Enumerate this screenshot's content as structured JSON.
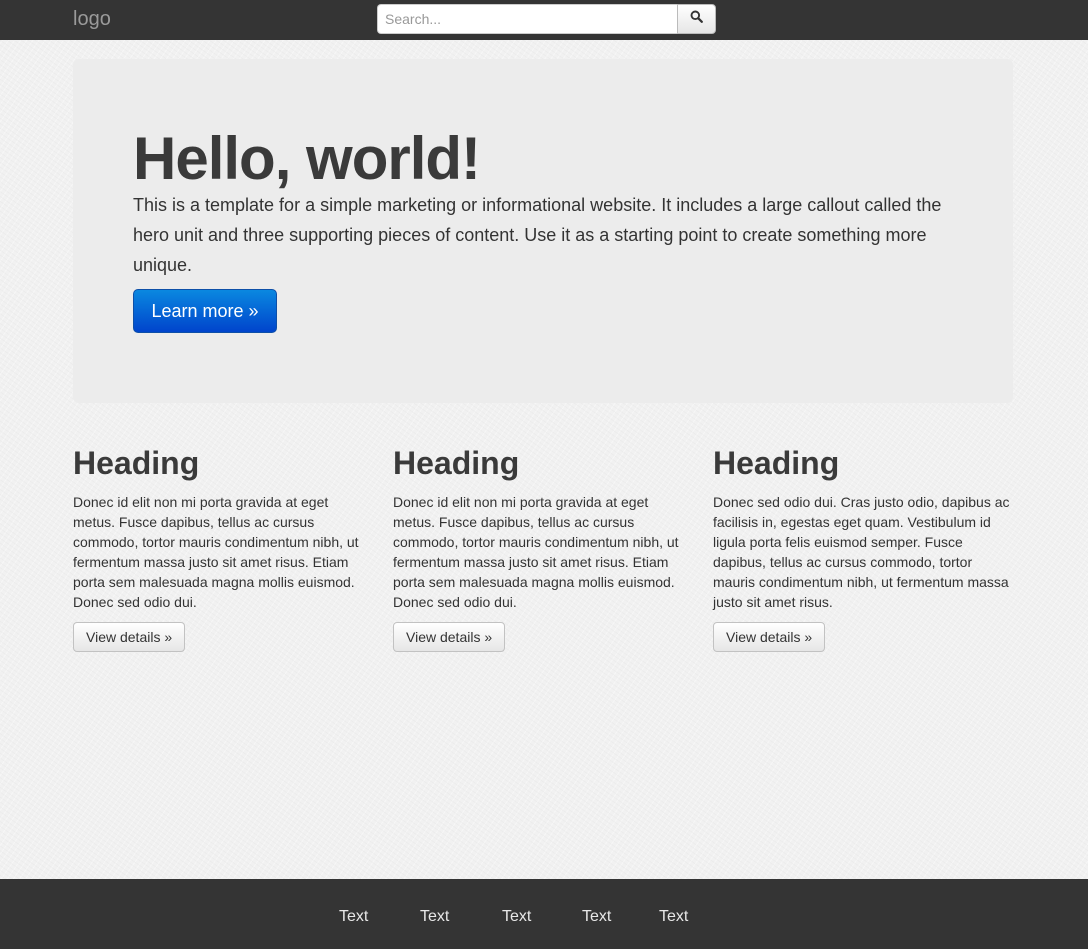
{
  "navbar": {
    "logo": "logo",
    "search": {
      "placeholder": "Search...",
      "value": "",
      "button_icon": "search-icon"
    }
  },
  "hero": {
    "title": "Hello, world!",
    "text": "This is a template for a simple marketing or informational website. It includes a large callout called the hero unit and three supporting pieces of content. Use it as a starting point to create something more unique.",
    "button_label": "Learn more »"
  },
  "columns": [
    {
      "heading": "Heading",
      "text": "Donec id elit non mi porta gravida at eget metus. Fusce dapibus, tellus ac cursus commodo, tortor mauris condimentum nibh, ut fermentum massa justo sit amet risus. Etiam porta sem malesuada magna mollis euismod. Donec sed odio dui.",
      "button_label": "View details »"
    },
    {
      "heading": "Heading",
      "text": "Donec id elit non mi porta gravida at eget metus. Fusce dapibus, tellus ac cursus commodo, tortor mauris condimentum nibh, ut fermentum massa justo sit amet risus. Etiam porta sem malesuada magna mollis euismod. Donec sed odio dui.",
      "button_label": "View details »"
    },
    {
      "heading": "Heading",
      "text": "Donec sed odio dui. Cras justo odio, dapibus ac facilisis in, egestas eget quam. Vestibulum id ligula porta felis euismod semper. Fusce dapibus, tellus ac cursus commodo, tortor mauris condimentum nibh, ut fermentum massa justo sit amet risus.",
      "button_label": "View details »"
    }
  ],
  "footer": {
    "links": [
      "Text",
      "Text",
      "Text",
      "Text",
      "Text"
    ]
  },
  "colors": {
    "navbar_bg": "#343434",
    "page_bg": "#f1f1f1",
    "hero_bg": "#ececec",
    "primary_button": "#0055d4",
    "footer_bg": "#343434"
  }
}
